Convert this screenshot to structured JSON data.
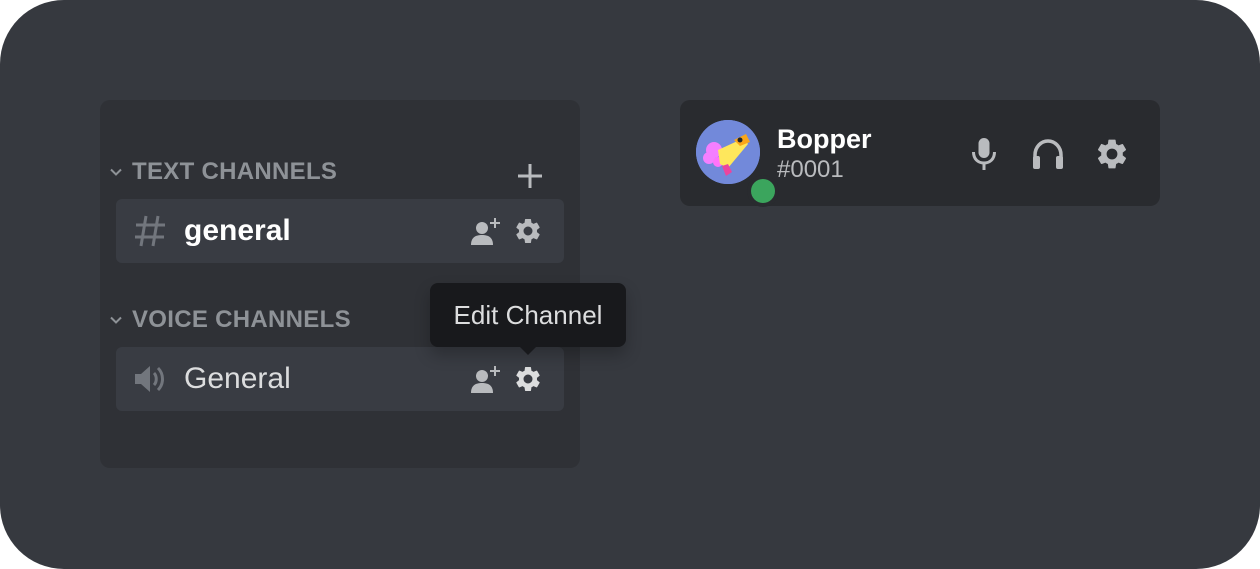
{
  "channels": {
    "text_category": "TEXT CHANNELS",
    "voice_category": "VOICE CHANNELS",
    "text_channel_name": "general",
    "voice_channel_name": "General"
  },
  "tooltip": {
    "text": "Edit Channel"
  },
  "user": {
    "name": "Bopper",
    "discriminator": "#0001",
    "status": "online"
  },
  "colors": {
    "background": "#36393f",
    "sidebar": "#2f3136",
    "user_panel": "#292b2f",
    "channel_selected": "#393c43",
    "tooltip": "#18191c",
    "online": "#3ba55d",
    "avatar_blurple": "#7289da"
  },
  "icons": {
    "category_chevron": "chevron-down-icon",
    "add_channel": "plus-icon",
    "text_channel": "hashtag-icon",
    "voice_channel": "speaker-icon",
    "invite": "add-person-icon",
    "settings": "gear-icon",
    "microphone": "microphone-icon",
    "headset": "headphones-icon"
  }
}
